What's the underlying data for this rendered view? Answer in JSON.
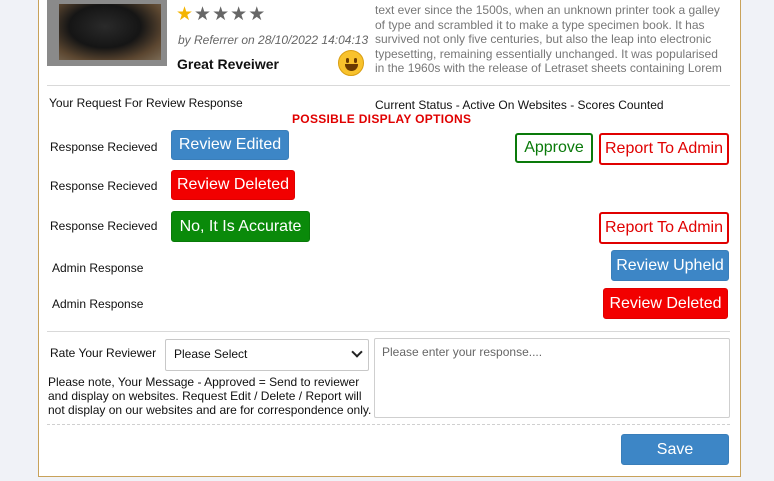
{
  "review": {
    "rating": 1,
    "max_rating": 5,
    "meta": "by Referrer on 28/10/2022 14:04:13",
    "reviewer_name": "Great Reveiwer",
    "text": "text ever since the 1500s, when an unknown printer took a galley of type and scrambled it to make a type specimen book. It has survived not only five centuries, but also the leap into electronic typesetting, remaining essentially unchanged. It was popularised in the 1960s with the release of Letraset sheets containing Lorem"
  },
  "request": {
    "label": "Your Request For Review Response",
    "status": "Current Status - Active On Websites - Scores Counted"
  },
  "display_options_title": "POSSIBLE DISPLAY OPTIONS",
  "rows": {
    "r1_label": "Response Recieved",
    "r1_button": "Review Edited",
    "approve": "Approve",
    "report1": "Report To Admin",
    "r2_label": "Response Recieved",
    "r2_button": "Review Deleted",
    "r3_label": "Response Recieved",
    "r3_button": "No, It Is Accurate",
    "report2": "Report To Admin",
    "r4_label": "Admin Response",
    "r4_button": "Review Upheld",
    "r5_label": "Admin Response",
    "r5_button": "Review Deleted"
  },
  "rate": {
    "label": "Rate Your Reviewer",
    "selected": "Please Select",
    "note": "Please note, Your Message - Approved = Send to reviewer and display on websites. Request Edit / Delete / Report will not display on our websites and are for correspondence only.",
    "response_placeholder": "Please enter your response....",
    "save": "Save"
  },
  "colors": {
    "blue": "#3d86c6",
    "red": "#f20000",
    "green": "#0a8a0a",
    "star": "#f4b400"
  }
}
